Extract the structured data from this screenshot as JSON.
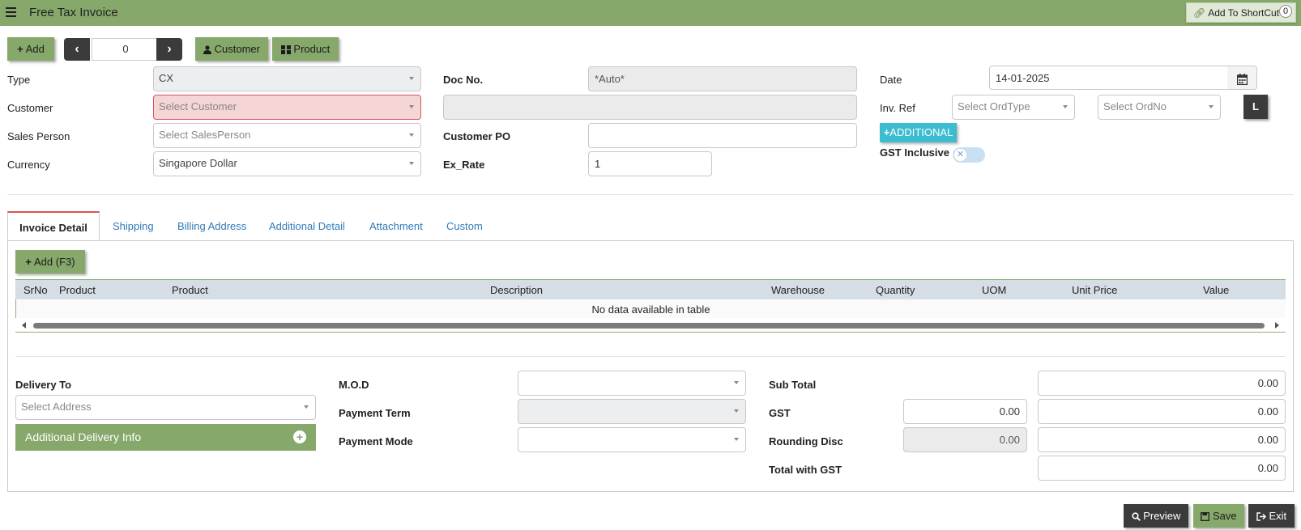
{
  "header": {
    "title": "Free Tax Invoice",
    "shortcut_label": "Add To ShortCut",
    "shortcut_count": "0"
  },
  "toolbar": {
    "add_label": "Add",
    "record_index": "0",
    "customer_label": "Customer",
    "product_label": "Product"
  },
  "form": {
    "type": {
      "label": "Type",
      "value": "CX"
    },
    "customer": {
      "label": "Customer",
      "placeholder": "Select Customer"
    },
    "sales_person": {
      "label": "Sales Person",
      "placeholder": "Select SalesPerson"
    },
    "currency": {
      "label": "Currency",
      "value": "Singapore Dollar"
    },
    "doc_no": {
      "label": "Doc No.",
      "value": "*Auto*"
    },
    "customer_name": {
      "value": ""
    },
    "customer_po": {
      "label": "Customer PO",
      "value": ""
    },
    "ex_rate": {
      "label": "Ex_Rate",
      "value": "1"
    },
    "date": {
      "label": "Date",
      "value": "14-01-2025"
    },
    "inv_ref": {
      "label": "Inv. Ref",
      "ord_type_placeholder": "Select OrdType",
      "ord_no_placeholder": "Select OrdNo"
    },
    "l_button": "L",
    "additional_button": "ADDITIONAL",
    "gst_inclusive": {
      "label": "GST Inclusive",
      "enabled": false
    }
  },
  "tabs": [
    {
      "label": "Invoice Detail",
      "active": true
    },
    {
      "label": "Shipping"
    },
    {
      "label": "Billing Address"
    },
    {
      "label": "Additional Detail"
    },
    {
      "label": "Attachment"
    },
    {
      "label": "Custom"
    }
  ],
  "detail": {
    "add_label": "Add (F3)",
    "columns": [
      "SrNo",
      "Product",
      "Product",
      "Description",
      "Warehouse",
      "Quantity",
      "UOM",
      "Unit Price",
      "Value"
    ],
    "empty_message": "No data available in table"
  },
  "footer": {
    "delivery_to": {
      "label": "Delivery To",
      "placeholder": "Select Address"
    },
    "additional_delivery_info": "Additional Delivery Info",
    "mod": {
      "label": "M.O.D",
      "value": ""
    },
    "payment_term": {
      "label": "Payment Term",
      "value": ""
    },
    "payment_mode": {
      "label": "Payment Mode",
      "value": ""
    },
    "sub_total": {
      "label": "Sub Total",
      "value": "0.00"
    },
    "gst": {
      "label": "GST",
      "rate": "0.00",
      "value": "0.00"
    },
    "rounding_disc": {
      "label": "Rounding Disc",
      "rate": "0.00",
      "value": "0.00"
    },
    "total_with_gst": {
      "label": "Total with GST",
      "value": "0.00"
    }
  },
  "actions": {
    "preview": "Preview",
    "save": "Save",
    "exit": "Exit"
  },
  "colors": {
    "accent_green": "#86a86b",
    "dark_button": "#3b3b3b",
    "info_cyan": "#3cbcd0",
    "error_pink": "#f6d5d6"
  }
}
